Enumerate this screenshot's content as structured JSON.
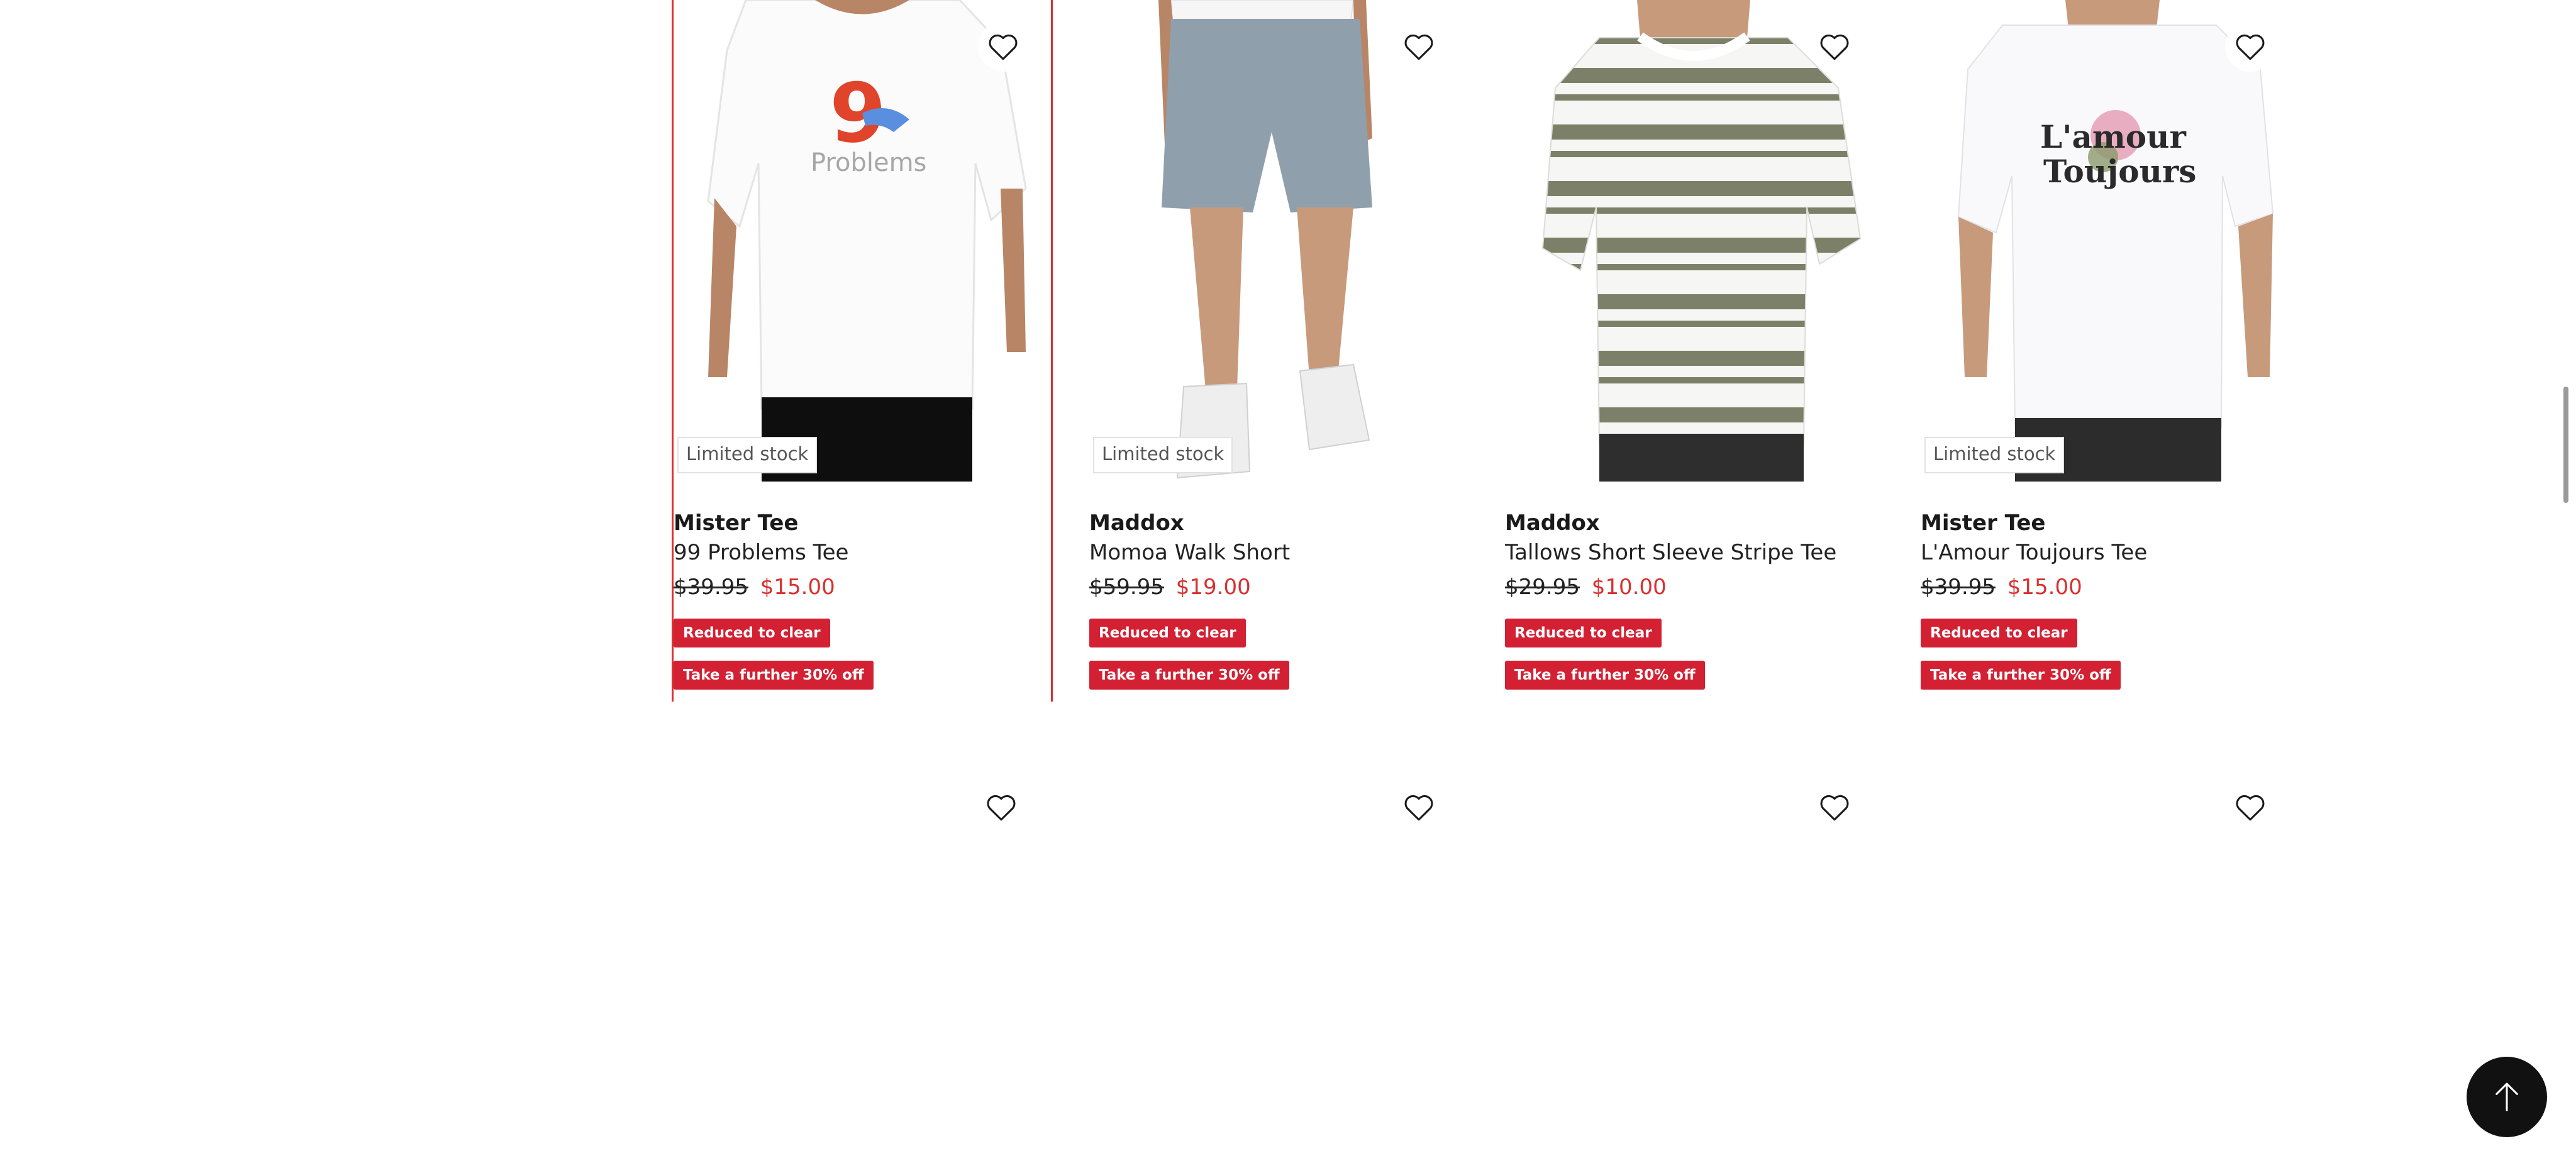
{
  "products": [
    {
      "brand": "Mister Tee",
      "name": "99 Problems Tee",
      "was_price": "$39.95",
      "price": "$15.00",
      "stock_label": "Limited stock",
      "badges": [
        "Reduced to clear",
        "Take a further 30% off"
      ],
      "print_text": "Problems"
    },
    {
      "brand": "Maddox",
      "name": "Momoa Walk Short",
      "was_price": "$59.95",
      "price": "$19.00",
      "stock_label": "Limited stock",
      "badges": [
        "Reduced to clear",
        "Take a further 30% off"
      ]
    },
    {
      "brand": "Maddox",
      "name": "Tallows Short Sleeve Stripe Tee",
      "was_price": "$29.95",
      "price": "$10.00",
      "stock_label": "",
      "badges": [
        "Reduced to clear",
        "Take a further 30% off"
      ]
    },
    {
      "brand": "Mister Tee",
      "name": "L'Amour Toujours Tee",
      "was_price": "$39.95",
      "price": "$15.00",
      "stock_label": "Limited stock",
      "badges": [
        "Reduced to clear",
        "Take a further 30% off"
      ],
      "print_text": [
        "L'amour",
        "Toujours"
      ]
    }
  ],
  "colors": {
    "sale_red": "#d8302f",
    "badge_red": "#d32033",
    "back_to_top_bg": "#111111"
  },
  "icons": {
    "wishlist": "heart-outline-icon",
    "back_to_top": "arrow-up-icon"
  }
}
